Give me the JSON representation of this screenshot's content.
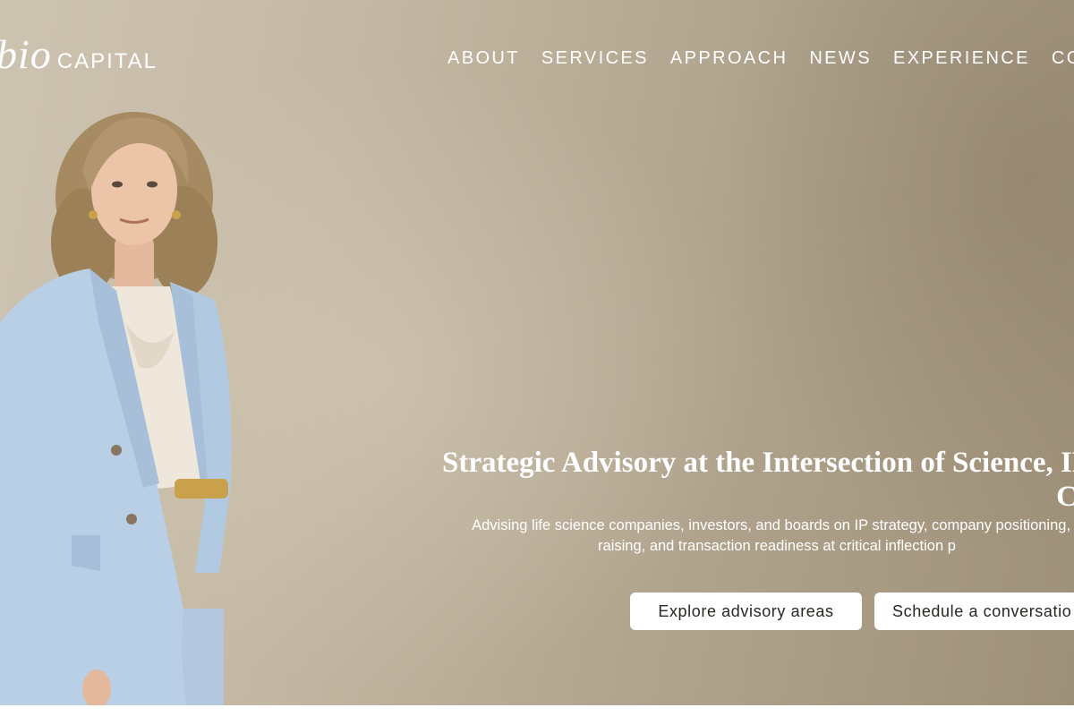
{
  "header": {
    "logo": {
      "script_text": "bio",
      "capital_text": "CAPITAL"
    },
    "nav": [
      {
        "label": "ABOUT"
      },
      {
        "label": "SERVICES"
      },
      {
        "label": "APPROACH"
      },
      {
        "label": "NEWS"
      },
      {
        "label": "EXPERIENCE"
      },
      {
        "label": "CONTA"
      }
    ]
  },
  "hero": {
    "headline_line1": "Strategic Advisory at the Intersection of Science, IP, a",
    "headline_line2": "Capi",
    "subtext_line1": "Advising life science companies, investors, and boards on IP strategy, company positioning, c",
    "subtext_line2": "raising, and transaction readiness at critical inflection p",
    "buttons": {
      "explore_label": "Explore advisory areas",
      "schedule_label": "Schedule a conversatio"
    }
  },
  "colors": {
    "background": "#b8ad9a",
    "text": "#ffffff",
    "button_bg": "#ffffff",
    "button_text": "#2a2622",
    "jacket": "#b9cfe6"
  },
  "icons": {
    "portrait": "woman-in-light-blue-suit"
  }
}
